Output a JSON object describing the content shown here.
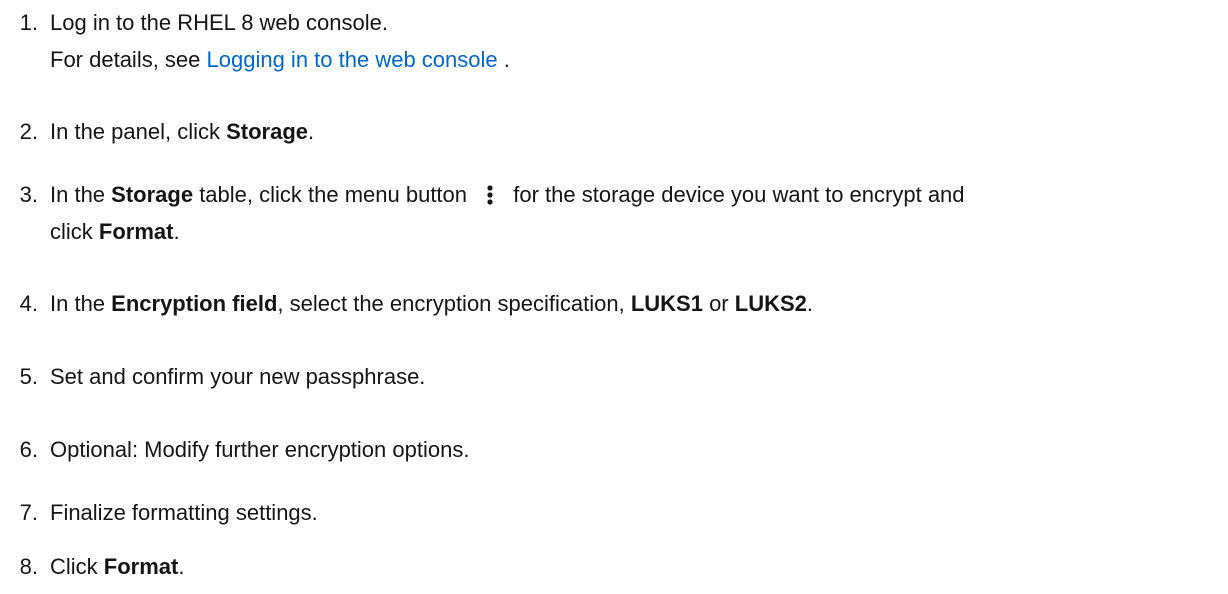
{
  "steps": [
    {
      "num": "1.",
      "text": "Log in to the RHEL 8 web console.",
      "detail_prefix": "For details, see ",
      "link_text": "Logging in to the web console",
      "detail_suffix": " ."
    },
    {
      "num": "2.",
      "pre": "In the panel, click ",
      "bold": "Storage",
      "post": "."
    },
    {
      "num": "3.",
      "pre": "In the ",
      "bold1": "Storage",
      "mid": " table, click the menu button ",
      "icon": "kebab-icon",
      "post": " for the storage device you want to encrypt and",
      "line2_pre": "click ",
      "bold2": "Format",
      "line2_post": "."
    },
    {
      "num": "4.",
      "pre": "In the ",
      "bold1": "Encryption field",
      "mid": ", select the encryption specification, ",
      "bold2": "LUKS1",
      "mid2": " or ",
      "bold3": "LUKS2",
      "post": "."
    },
    {
      "num": "5.",
      "text": "Set and confirm your new passphrase."
    },
    {
      "num": "6.",
      "text": "Optional: Modify further encryption options."
    },
    {
      "num": "7.",
      "text": "Finalize formatting settings."
    },
    {
      "num": "8.",
      "pre": "Click ",
      "bold": "Format",
      "post": "."
    }
  ]
}
